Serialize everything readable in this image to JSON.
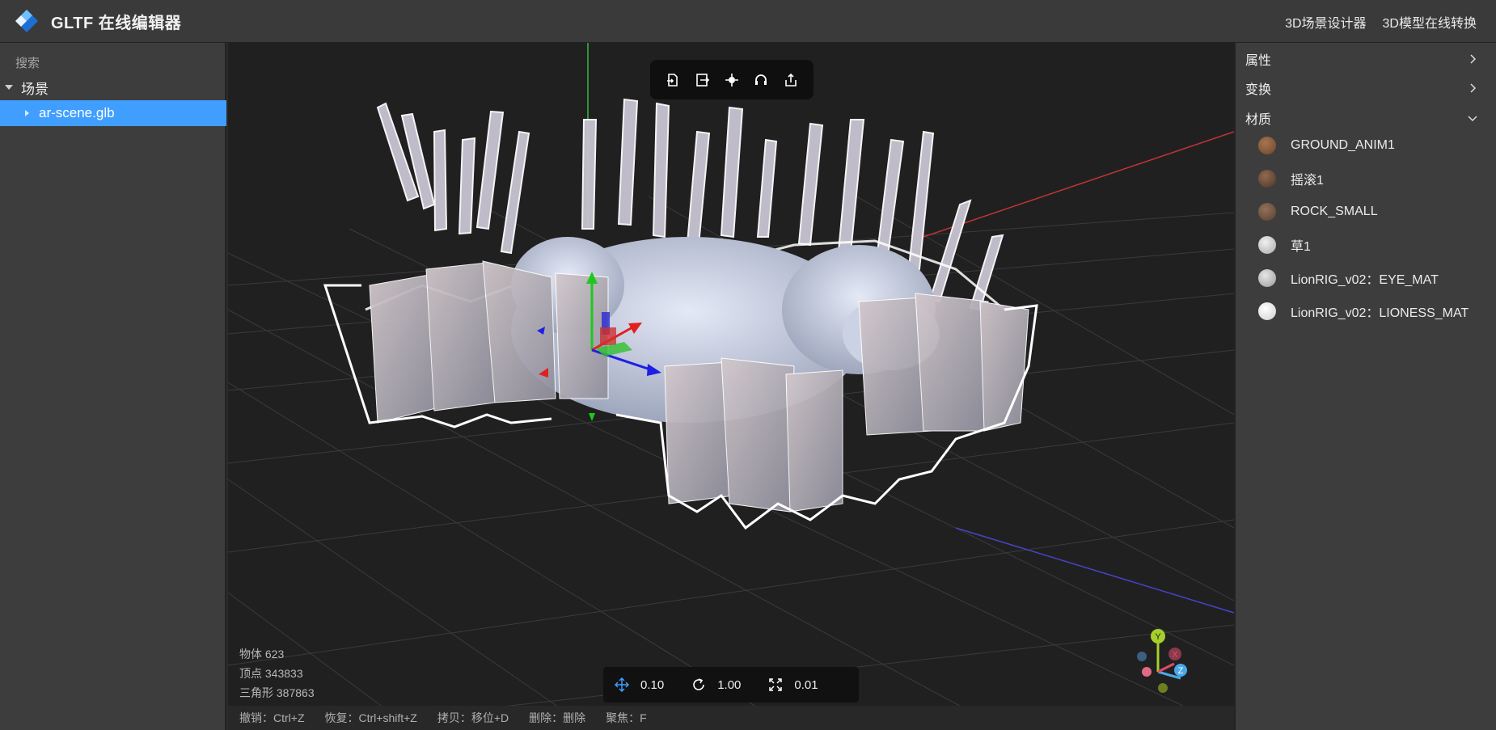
{
  "header": {
    "title": "GLTF 在线编辑器",
    "links": [
      "3D场景设计器",
      "3D模型在线转换"
    ]
  },
  "left_panel": {
    "search_placeholder": "搜索",
    "tree_root": "场景",
    "tree_item": "ar-scene.glb"
  },
  "viewport": {
    "toolbar_icons": [
      "import-icon",
      "export-icon",
      "focus-icon",
      "headset-icon",
      "share-icon"
    ],
    "stats": {
      "objects": "物体 623",
      "vertices": "顶点 343833",
      "triangles": "三角形 387863"
    },
    "snap": {
      "move": "0.10",
      "rotate": "1.00",
      "scale": "0.01"
    },
    "shortcuts": [
      "撤销：Ctrl+Z",
      "恢复：Ctrl+shift+Z",
      "拷贝：移位+D",
      "删除：删除",
      "聚焦：F"
    ],
    "gizmo_labels": {
      "y": "Y",
      "x": "X",
      "z": "Z"
    }
  },
  "right_panel": {
    "sections": {
      "properties": "属性",
      "transform": "变换",
      "material": "材质"
    },
    "materials": [
      {
        "name": "GROUND_ANIM1",
        "color": "#7a5236"
      },
      {
        "name": "摇滚1",
        "color": "#6b4a35"
      },
      {
        "name": "ROCK_SMALL",
        "color": "#6e5240"
      },
      {
        "name": "草1",
        "color": "#c8c8c8"
      },
      {
        "name": "LionRIG_v02：EYE_MAT",
        "color": "#b9b9b9"
      },
      {
        "name": "LionRIG_v02：LIONESS_MAT",
        "color": "#e8e8e8"
      }
    ]
  },
  "colors": {
    "accent": "#409eff",
    "background": "#202020",
    "panel": "#3d3d3d"
  }
}
